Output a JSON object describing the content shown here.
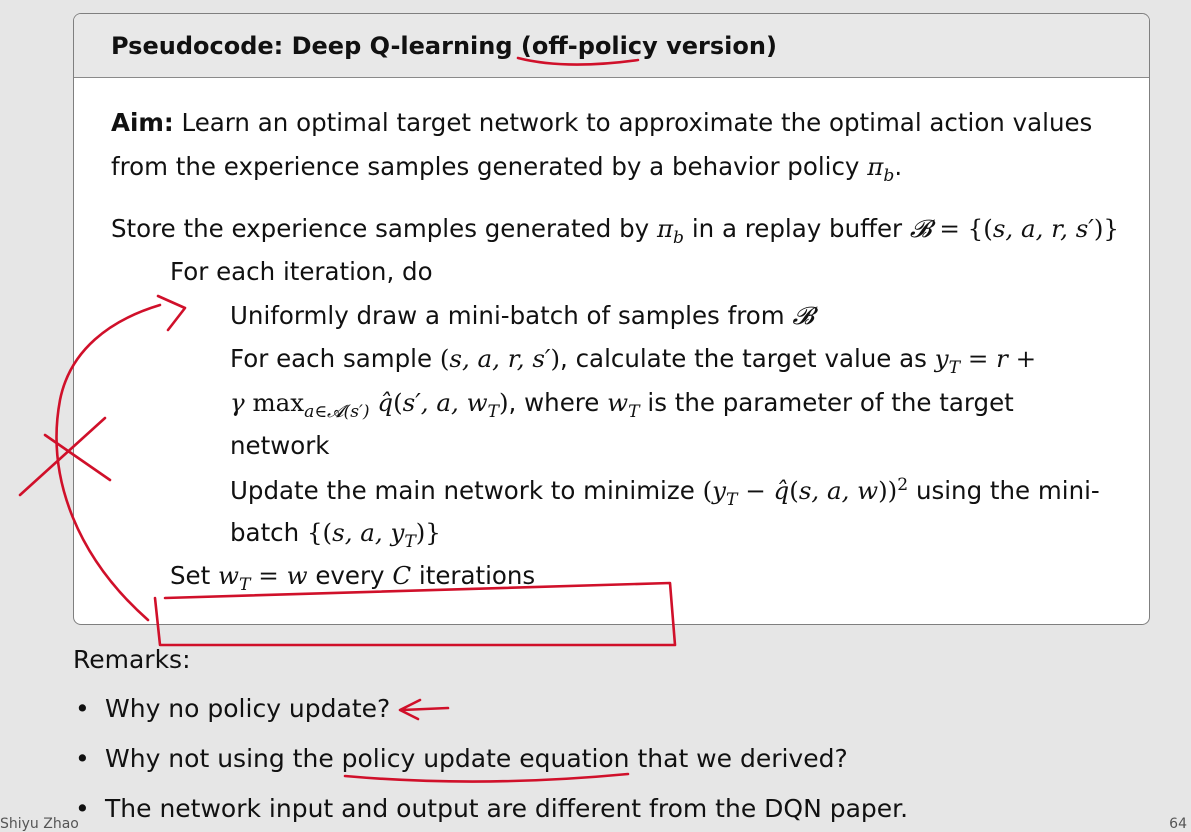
{
  "box": {
    "header": "Pseudocode: Deep Q-learning (off-policy version)",
    "aim_label": "Aim:",
    "aim_line1": "Learn an optimal target network to approximate the optimal action values",
    "aim_line2_text": "from the experience samples generated by a behavior policy",
    "store_text": "Store the experience samples generated by",
    "store_text2": "in a replay buffer",
    "for_each_iter": "For each iteration, do",
    "draw_text": "Uniformly draw a mini-batch of samples from",
    "sample_text": "For each sample",
    "sample_text2": ", calculate the target value as",
    "where_text": ", where",
    "where_text2": "is the parameter of the target",
    "network_text": "network",
    "update_text": "Update the main network to minimize",
    "update_text2": "using the mini-",
    "batch_text": "batch",
    "set_text": "Set",
    "every_text": "every",
    "iterations_text": "iterations"
  },
  "remarks": {
    "title": "Remarks:",
    "items": [
      "Why no policy update?",
      "Why not using the policy update equation that we derived?",
      "The network input and output are different from the DQN paper."
    ]
  },
  "footer": {
    "left": "Shiyu Zhao",
    "right": "64"
  },
  "annotation_color": "#d0102a"
}
